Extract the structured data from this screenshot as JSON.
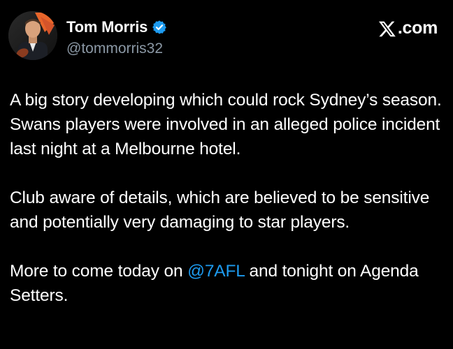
{
  "author": {
    "display_name": "Tom Morris",
    "handle": "@tommorris32",
    "verified": true,
    "verified_color": "#1d9bf0"
  },
  "source": {
    "icon": "x-logo-icon",
    "label": ".com"
  },
  "tweet": {
    "paragraph_1": "A big story developing which could rock Sydney’s season. Swans players were involved in an alleged police incident last night at a Melbourne hotel.",
    "paragraph_2": "Club aware of details, which are believed to be sensitive and potentially very damaging to star players.",
    "paragraph_3_before": "More to come today on ",
    "paragraph_3_mention": "@7AFL",
    "paragraph_3_after": " and tonight on Agenda Setters."
  },
  "colors": {
    "background": "#000000",
    "text": "#ffffff",
    "secondary_text": "#8b98a5",
    "link": "#1d9bf0"
  }
}
